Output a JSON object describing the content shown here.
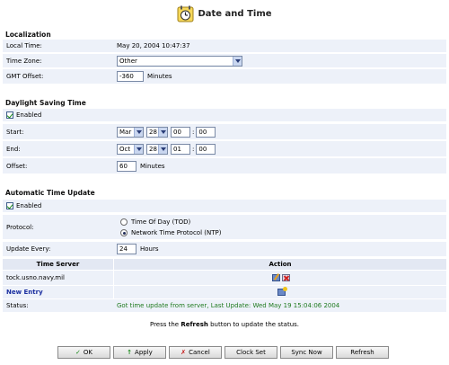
{
  "page": {
    "title": "Date and Time",
    "icon": "clock-calendar-icon"
  },
  "localization": {
    "title": "Localization",
    "local_time_label": "Local Time:",
    "local_time_value": "May 20, 2004 10:47:37",
    "time_zone_label": "Time Zone:",
    "time_zone_value": "Other",
    "gmt_offset_label": "GMT Offset:",
    "gmt_offset_value": "-360",
    "gmt_offset_unit": "Minutes"
  },
  "dst": {
    "title": "Daylight Saving Time",
    "enabled_label": "Enabled",
    "enabled": true,
    "start_label": "Start:",
    "start": {
      "month": "Mar",
      "day": "28",
      "hour": "00",
      "minute": "00"
    },
    "end_label": "End:",
    "end": {
      "month": "Oct",
      "day": "28",
      "hour": "01",
      "minute": "00"
    },
    "offset_label": "Offset:",
    "offset_value": "60",
    "offset_unit": "Minutes"
  },
  "auto_update": {
    "title": "Automatic Time Update",
    "enabled_label": "Enabled",
    "enabled": true,
    "protocol_label": "Protocol:",
    "protocol_options": [
      "Time Of Day (TOD)",
      "Network Time Protocol (NTP)"
    ],
    "protocol_selected": "Network Time Protocol (NTP)",
    "update_every_label": "Update Every:",
    "update_every_value": "24",
    "update_every_unit": "Hours",
    "table_headers": {
      "server": "Time Server",
      "action": "Action"
    },
    "servers": [
      "tock.usno.navy.mil"
    ],
    "new_entry_label": "New Entry",
    "status_label": "Status:",
    "status_value": "Got time update from server, Last Update: Wed May 19 15:04:06 2004"
  },
  "hint": {
    "prefix": "Press the ",
    "bold": "Refresh",
    "suffix": " button to update the status."
  },
  "buttons": {
    "ok": "OK",
    "apply": "Apply",
    "cancel": "Cancel",
    "clock_set": "Clock Set",
    "sync_now": "Sync Now",
    "refresh": "Refresh"
  },
  "colors": {
    "row_background": "#edf1f9",
    "status_text": "#1f7a1f",
    "link": "#1b2fa0"
  }
}
